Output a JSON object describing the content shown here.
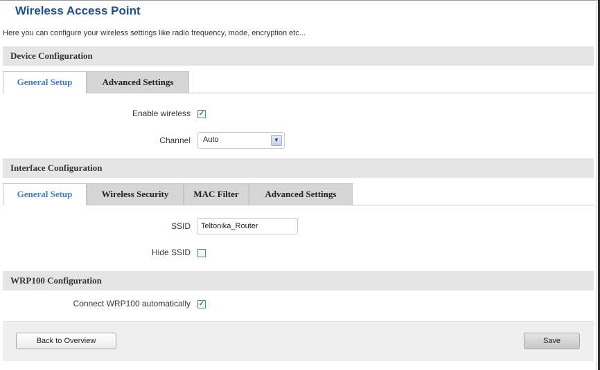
{
  "page": {
    "title": "Wireless Access Point",
    "description": "Here you can configure your wireless settings like radio frequency, mode, encryption etc..."
  },
  "device_config": {
    "header": "Device Configuration",
    "tabs": [
      {
        "label": "General Setup",
        "active": true
      },
      {
        "label": "Advanced Settings",
        "active": false
      }
    ],
    "fields": {
      "enable_wireless": {
        "label": "Enable wireless",
        "checked": true
      },
      "channel": {
        "label": "Channel",
        "value": "Auto"
      }
    }
  },
  "interface_config": {
    "header": "Interface Configuration",
    "tabs": [
      {
        "label": "General Setup",
        "active": true
      },
      {
        "label": "Wireless Security",
        "active": false
      },
      {
        "label": "MAC Filter",
        "active": false
      },
      {
        "label": "Advanced Settings",
        "active": false
      }
    ],
    "fields": {
      "ssid": {
        "label": "SSID",
        "value": "Teltonika_Router"
      },
      "hide_ssid": {
        "label": "Hide SSID",
        "checked": false
      }
    }
  },
  "wrp100_config": {
    "header": "WRP100 Configuration",
    "fields": {
      "connect_automatically": {
        "label": "Connect WRP100 automatically",
        "checked": true
      }
    }
  },
  "footer": {
    "back_label": "Back to Overview",
    "save_label": "Save"
  },
  "glyphs": {
    "check": "✓",
    "dropdown_arrow": "▼"
  },
  "colors": {
    "title": "#1f4e8f",
    "active_tab": "#3d7ec8",
    "section_bg": "#e5e5e5",
    "checkbox_check": "#2e8b2e"
  }
}
